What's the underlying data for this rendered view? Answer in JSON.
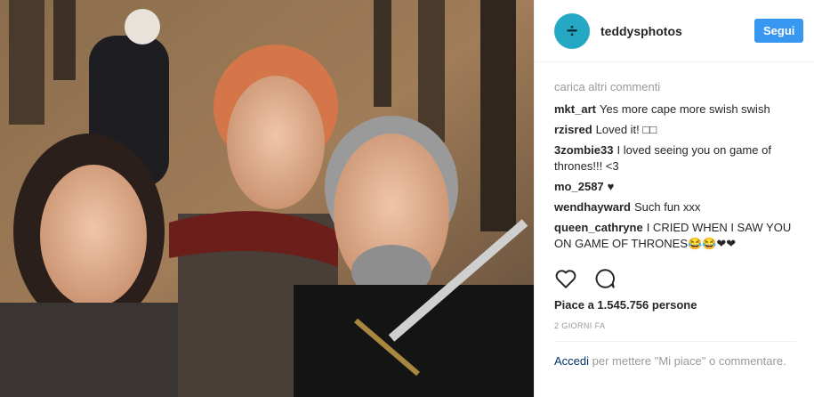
{
  "header": {
    "username": "teddysphotos",
    "follow_label": "Segui"
  },
  "comments": {
    "load_more": "carica altri commenti",
    "items": [
      {
        "user": "mkt_art",
        "text": "Yes more cape more swish swish"
      },
      {
        "user": "rzisred",
        "text": "Loved it! □□"
      },
      {
        "user": "3zombie33",
        "text": "I loved seeing you on game of thrones!!! <3"
      },
      {
        "user": "mo_2587",
        "text": "♥"
      },
      {
        "user": "wendhayward",
        "text": "Such fun xxx"
      },
      {
        "user": "queen_cathryne",
        "text": "I CRIED WHEN I SAW YOU ON GAME OF THRONES😂😂❤❤"
      }
    ]
  },
  "actions": {
    "like_icon": "heart-icon",
    "comment_icon": "speech-bubble-icon"
  },
  "likes": "Piace a 1.545.756 persone",
  "time": "2 GIORNI FA",
  "login": {
    "link": "Accedi",
    "text": " per mettere \"Mi piace\" o commentare."
  }
}
